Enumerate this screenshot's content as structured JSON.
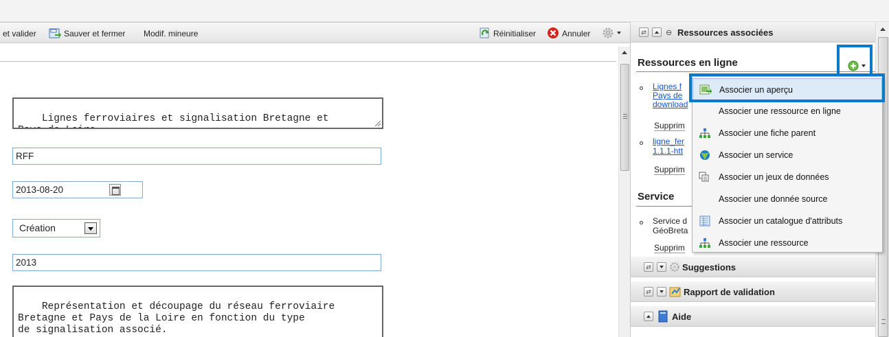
{
  "toolbar": {
    "save_validate": "et valider",
    "save_close": "Sauver et fermer",
    "minor_edit": "Modif. mineure",
    "reset": "Réinitialiser",
    "cancel": "Annuler"
  },
  "form": {
    "title_value": "Lignes ferroviaires et signalisation Bretagne et\nPays de Loire",
    "organisation_value": "RFF",
    "date_value": "2013-08-20",
    "date_type_value": "Création",
    "edition_value": "2013",
    "abstract_value": "Représentation et découpage du réseau ferroviaire\nBretagne et Pays de la Loire en fonction du type\nde signalisation associé."
  },
  "panel": {
    "header_title": "Ressources associées",
    "online_title": "Ressources en ligne",
    "online_items": [
      {
        "link_line1": "Lignes f",
        "link_line2": "Pays de",
        "link_line3": "download",
        "delete": "Supprim"
      },
      {
        "link_line1": "ligne_fer",
        "link_line2": "1.1.1-htt",
        "delete": "Supprim"
      }
    ],
    "service_title": "Service",
    "service_items": [
      {
        "text_line1": "Service d",
        "text_line2": "GéoBreta",
        "delete": "Supprim"
      }
    ],
    "suggestions_title": "Suggestions",
    "validation_title": "Rapport de validation",
    "help_title": "Aide"
  },
  "menu": {
    "items": [
      {
        "label": "Associer un aperçu",
        "icon": "thumbnail-icon"
      },
      {
        "label": "Associer une ressource en ligne",
        "icon": ""
      },
      {
        "label": "Associer une fiche parent",
        "icon": "hierarchy-icon"
      },
      {
        "label": "Associer un service",
        "icon": "service-icon"
      },
      {
        "label": "Associer un jeux de données",
        "icon": "dataset-icon"
      },
      {
        "label": "Associer une donnée source",
        "icon": ""
      },
      {
        "label": "Associer un catalogue d'attributs",
        "icon": "catalog-icon"
      },
      {
        "label": "Associer une ressource",
        "icon": "hierarchy-icon"
      }
    ]
  },
  "colors": {
    "highlight": "#0a79c9",
    "link": "#1155cc"
  }
}
